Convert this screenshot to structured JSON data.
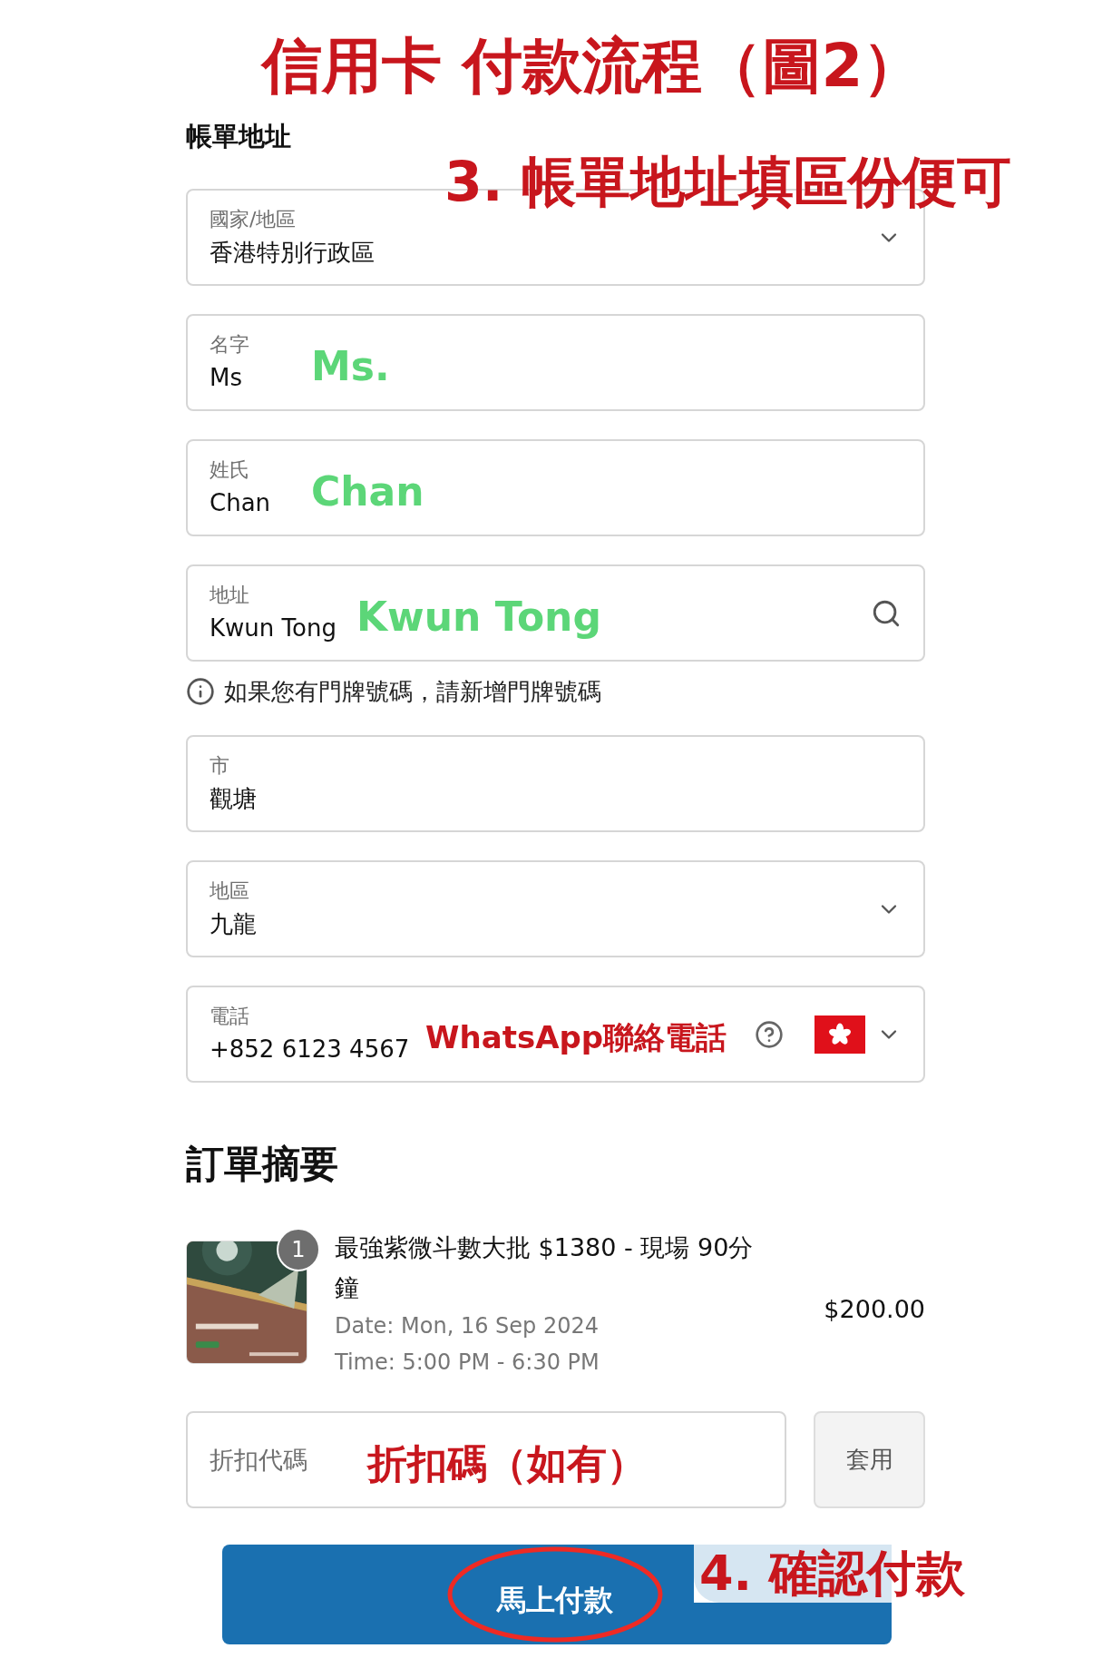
{
  "title": "信用卡 付款流程（圖2）",
  "billing": {
    "heading": "帳單地址",
    "annotation": {
      "text": "3. 帳單地址填區份便可",
      "color": "#c8161d"
    },
    "fields": [
      {
        "kind": "select",
        "label": "國家/地區",
        "value": "香港特別行政區"
      },
      {
        "kind": "text",
        "label": "名字",
        "value": "Ms",
        "annotation": {
          "text": "Ms.",
          "color": "#5cd678"
        }
      },
      {
        "kind": "text",
        "label": "姓氏",
        "value": "Chan",
        "annotation": {
          "text": "Chan",
          "color": "#5cd678"
        }
      },
      {
        "kind": "search",
        "label": "地址",
        "value": "Kwun Tong",
        "annotation": {
          "text": "Kwun Tong",
          "color": "#5cd678"
        },
        "note": "如果您有門牌號碼，請新增門牌號碼"
      },
      {
        "kind": "text",
        "label": "市",
        "value": "觀塘"
      },
      {
        "kind": "select",
        "label": "地區",
        "value": "九龍"
      },
      {
        "kind": "phone",
        "label": "電話",
        "value": "+852 6123 4567",
        "annotation": {
          "text": "WhatsApp聯絡電話",
          "color": "#c8161d"
        }
      }
    ]
  },
  "order_summary": {
    "heading": "訂單摘要",
    "items": [
      {
        "kind": "picture",
        "quantity": "1",
        "name": "最強紫微斗數大批 $1380 - 現場 90分鐘",
        "date": "Date: Mon, 16 Sep 2024",
        "time": "Time: 5:00 PM - 6:30 PM",
        "price": "$200.00"
      }
    ]
  },
  "discount": {
    "placeholder": "折扣代碼",
    "annotation": {
      "text": "折扣碼（如有）",
      "color": "#c8161d"
    },
    "button": "套用"
  },
  "pay": {
    "button": "馬上付款",
    "annotation": {
      "text": "4. 確認付款",
      "color": "#c8161d"
    }
  }
}
